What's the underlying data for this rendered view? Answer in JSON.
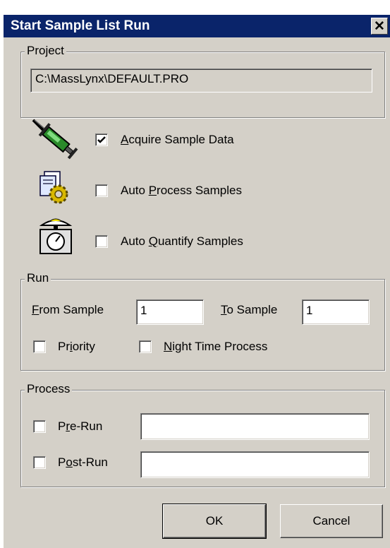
{
  "window": {
    "title": "Start Sample List Run",
    "close_glyph": "✕"
  },
  "project": {
    "group_label": "Project",
    "path": "C:\\MassLynx\\DEFAULT.PRO"
  },
  "options": [
    {
      "icon": "syringe-icon",
      "checked": true,
      "pre": "",
      "key": "A",
      "post": "cquire Sample Data"
    },
    {
      "icon": "process-gear-icon",
      "checked": false,
      "pre": "Auto ",
      "key": "P",
      "post": "rocess Samples"
    },
    {
      "icon": "scale-icon",
      "checked": false,
      "pre": "Auto ",
      "key": "Q",
      "post": "uantify Samples"
    }
  ],
  "run": {
    "group_label": "Run",
    "from_sample": {
      "pre": "",
      "key": "F",
      "post": "rom Sample",
      "value": "1"
    },
    "to_sample": {
      "pre": "",
      "key": "T",
      "post": "o Sample",
      "value": "1"
    },
    "priority": {
      "pre": "Pr",
      "key": "i",
      "post": "ority",
      "checked": false
    },
    "night_time": {
      "pre": "",
      "key": "N",
      "post": "ight Time Process",
      "checked": false
    }
  },
  "process": {
    "group_label": "Process",
    "pre_run": {
      "pre": "P",
      "key": "r",
      "post": "e-Run",
      "checked": false,
      "value": ""
    },
    "post_run": {
      "pre": "P",
      "key": "o",
      "post": "st-Run",
      "checked": false,
      "value": ""
    }
  },
  "buttons": {
    "ok": "OK",
    "cancel": "Cancel"
  }
}
